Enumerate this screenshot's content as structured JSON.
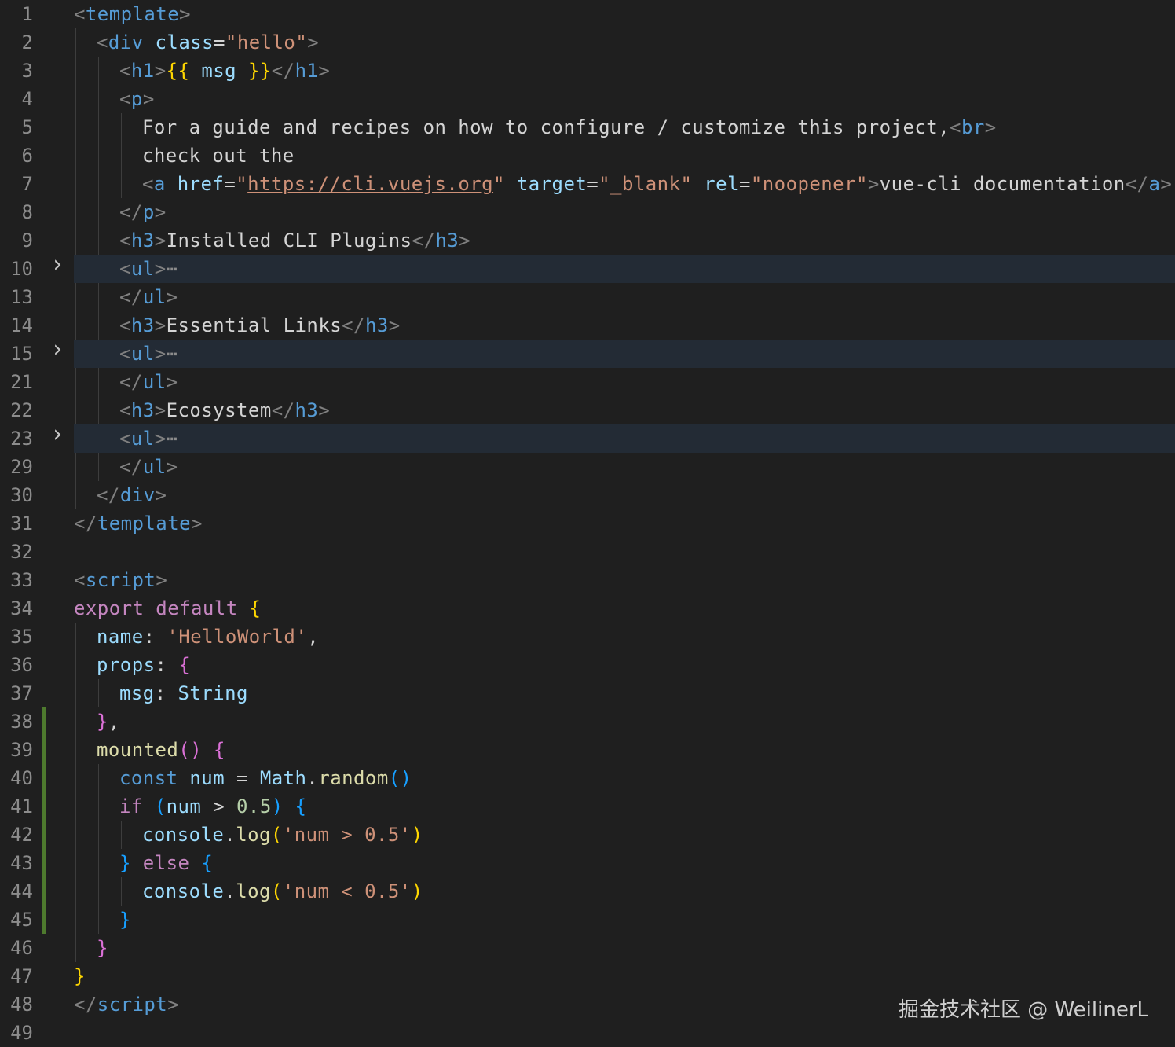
{
  "colors": {
    "background": "#1f1f1f",
    "folded_line_highlight": "#232b35",
    "line_number": "#8c8c8c",
    "git_modified_bar": "#4e7a2e",
    "tag": "#569cd6",
    "string": "#ce9178",
    "attribute": "#9cdcfe",
    "keyword": "#c586c0",
    "function": "#dcdcaa"
  },
  "watermark": "掘金技术社区 @ WeilinerL",
  "lines": [
    {
      "n": "1",
      "indent": 0,
      "tokens": [
        [
          "<",
          "tk-punct"
        ],
        [
          "template",
          "tk-tag"
        ],
        [
          ">",
          "tk-punct"
        ]
      ]
    },
    {
      "n": "2",
      "indent": 1,
      "tokens": [
        [
          "<",
          "tk-punct"
        ],
        [
          "div",
          "tk-tag"
        ],
        [
          " ",
          "tk-text"
        ],
        [
          "class",
          "tk-attr"
        ],
        [
          "=",
          "tk-text"
        ],
        [
          "\"hello\"",
          "tk-str"
        ],
        [
          ">",
          "tk-punct"
        ]
      ]
    },
    {
      "n": "3",
      "indent": 2,
      "tokens": [
        [
          "<",
          "tk-punct"
        ],
        [
          "h1",
          "tk-tag"
        ],
        [
          ">",
          "tk-punct"
        ],
        [
          "{{",
          "tk-brace1"
        ],
        [
          " msg ",
          "tk-var"
        ],
        [
          "}}",
          "tk-brace1"
        ],
        [
          "</",
          "tk-punct"
        ],
        [
          "h1",
          "tk-tag"
        ],
        [
          ">",
          "tk-punct"
        ]
      ]
    },
    {
      "n": "4",
      "indent": 2,
      "tokens": [
        [
          "<",
          "tk-punct"
        ],
        [
          "p",
          "tk-tag"
        ],
        [
          ">",
          "tk-punct"
        ]
      ]
    },
    {
      "n": "5",
      "indent": 3,
      "tokens": [
        [
          "For a guide and recipes on how to configure / customize this project,",
          "tk-text"
        ],
        [
          "<",
          "tk-punct"
        ],
        [
          "br",
          "tk-tag"
        ],
        [
          ">",
          "tk-punct"
        ]
      ]
    },
    {
      "n": "6",
      "indent": 3,
      "tokens": [
        [
          "check out the",
          "tk-text"
        ]
      ]
    },
    {
      "n": "7",
      "indent": 3,
      "tokens": [
        [
          "<",
          "tk-punct"
        ],
        [
          "a",
          "tk-tag"
        ],
        [
          " ",
          "tk-text"
        ],
        [
          "href",
          "tk-attr"
        ],
        [
          "=",
          "tk-text"
        ],
        [
          "\"",
          "tk-str"
        ],
        [
          "https://cli.vuejs.org",
          "tk-link"
        ],
        [
          "\"",
          "tk-str"
        ],
        [
          " ",
          "tk-text"
        ],
        [
          "target",
          "tk-attr"
        ],
        [
          "=",
          "tk-text"
        ],
        [
          "\"_blank\"",
          "tk-str"
        ],
        [
          " ",
          "tk-text"
        ],
        [
          "rel",
          "tk-attr"
        ],
        [
          "=",
          "tk-text"
        ],
        [
          "\"noopener\"",
          "tk-str"
        ],
        [
          ">",
          "tk-punct"
        ],
        [
          "vue-cli documentation",
          "tk-text"
        ],
        [
          "</",
          "tk-punct"
        ],
        [
          "a",
          "tk-tag"
        ],
        [
          ">",
          "tk-punct"
        ],
        [
          ".",
          "tk-text"
        ]
      ]
    },
    {
      "n": "8",
      "indent": 2,
      "tokens": [
        [
          "</",
          "tk-punct"
        ],
        [
          "p",
          "tk-tag"
        ],
        [
          ">",
          "tk-punct"
        ]
      ]
    },
    {
      "n": "9",
      "indent": 2,
      "tokens": [
        [
          "<",
          "tk-punct"
        ],
        [
          "h3",
          "tk-tag"
        ],
        [
          ">",
          "tk-punct"
        ],
        [
          "Installed CLI Plugins",
          "tk-text"
        ],
        [
          "</",
          "tk-punct"
        ],
        [
          "h3",
          "tk-tag"
        ],
        [
          ">",
          "tk-punct"
        ]
      ]
    },
    {
      "n": "10",
      "indent": 2,
      "folded": true,
      "tokens": [
        [
          "<",
          "tk-punct"
        ],
        [
          "ul",
          "tk-tag"
        ],
        [
          ">",
          "tk-punct"
        ],
        [
          "⋯",
          "tk-dots"
        ]
      ]
    },
    {
      "n": "13",
      "indent": 2,
      "tokens": [
        [
          "</",
          "tk-punct"
        ],
        [
          "ul",
          "tk-tag"
        ],
        [
          ">",
          "tk-punct"
        ]
      ]
    },
    {
      "n": "14",
      "indent": 2,
      "tokens": [
        [
          "<",
          "tk-punct"
        ],
        [
          "h3",
          "tk-tag"
        ],
        [
          ">",
          "tk-punct"
        ],
        [
          "Essential Links",
          "tk-text"
        ],
        [
          "</",
          "tk-punct"
        ],
        [
          "h3",
          "tk-tag"
        ],
        [
          ">",
          "tk-punct"
        ]
      ]
    },
    {
      "n": "15",
      "indent": 2,
      "folded": true,
      "tokens": [
        [
          "<",
          "tk-punct"
        ],
        [
          "ul",
          "tk-tag"
        ],
        [
          ">",
          "tk-punct"
        ],
        [
          "⋯",
          "tk-dots"
        ]
      ]
    },
    {
      "n": "21",
      "indent": 2,
      "tokens": [
        [
          "</",
          "tk-punct"
        ],
        [
          "ul",
          "tk-tag"
        ],
        [
          ">",
          "tk-punct"
        ]
      ]
    },
    {
      "n": "22",
      "indent": 2,
      "tokens": [
        [
          "<",
          "tk-punct"
        ],
        [
          "h3",
          "tk-tag"
        ],
        [
          ">",
          "tk-punct"
        ],
        [
          "Ecosystem",
          "tk-text"
        ],
        [
          "</",
          "tk-punct"
        ],
        [
          "h3",
          "tk-tag"
        ],
        [
          ">",
          "tk-punct"
        ]
      ]
    },
    {
      "n": "23",
      "indent": 2,
      "folded": true,
      "tokens": [
        [
          "<",
          "tk-punct"
        ],
        [
          "ul",
          "tk-tag"
        ],
        [
          ">",
          "tk-punct"
        ],
        [
          "⋯",
          "tk-dots"
        ]
      ]
    },
    {
      "n": "29",
      "indent": 2,
      "tokens": [
        [
          "</",
          "tk-punct"
        ],
        [
          "ul",
          "tk-tag"
        ],
        [
          ">",
          "tk-punct"
        ]
      ]
    },
    {
      "n": "30",
      "indent": 1,
      "tokens": [
        [
          "</",
          "tk-punct"
        ],
        [
          "div",
          "tk-tag"
        ],
        [
          ">",
          "tk-punct"
        ]
      ]
    },
    {
      "n": "31",
      "indent": 0,
      "tokens": [
        [
          "</",
          "tk-punct"
        ],
        [
          "template",
          "tk-tag"
        ],
        [
          ">",
          "tk-punct"
        ]
      ]
    },
    {
      "n": "32",
      "indent": 0,
      "tokens": []
    },
    {
      "n": "33",
      "indent": 0,
      "tokens": [
        [
          "<",
          "tk-punct"
        ],
        [
          "script",
          "tk-tag"
        ],
        [
          ">",
          "tk-punct"
        ]
      ]
    },
    {
      "n": "34",
      "indent": 0,
      "tokens": [
        [
          "export default ",
          "tk-kw"
        ],
        [
          "{",
          "tk-brace1"
        ]
      ]
    },
    {
      "n": "35",
      "indent": 1,
      "tokens": [
        [
          "name",
          "tk-var"
        ],
        [
          ": ",
          "tk-text"
        ],
        [
          "'HelloWorld'",
          "tk-str"
        ],
        [
          ",",
          "tk-text"
        ]
      ]
    },
    {
      "n": "36",
      "indent": 1,
      "tokens": [
        [
          "props",
          "tk-var"
        ],
        [
          ": ",
          "tk-text"
        ],
        [
          "{",
          "tk-brace2"
        ]
      ]
    },
    {
      "n": "37",
      "indent": 2,
      "tokens": [
        [
          "msg",
          "tk-var"
        ],
        [
          ": ",
          "tk-text"
        ],
        [
          "String",
          "tk-var"
        ]
      ]
    },
    {
      "n": "38",
      "indent": 1,
      "tokens": [
        [
          "}",
          "tk-brace2"
        ],
        [
          ",",
          "tk-text"
        ]
      ]
    },
    {
      "n": "39",
      "indent": 1,
      "tokens": [
        [
          "mounted",
          "tk-fn"
        ],
        [
          "()",
          "tk-brace2"
        ],
        [
          " ",
          "tk-text"
        ],
        [
          "{",
          "tk-brace2"
        ]
      ]
    },
    {
      "n": "40",
      "indent": 2,
      "tokens": [
        [
          "const ",
          "tk-kw2"
        ],
        [
          "num",
          "tk-var"
        ],
        [
          " = ",
          "tk-text"
        ],
        [
          "Math",
          "tk-var"
        ],
        [
          ".",
          "tk-text"
        ],
        [
          "random",
          "tk-fn"
        ],
        [
          "()",
          "tk-brace3"
        ]
      ]
    },
    {
      "n": "41",
      "indent": 2,
      "tokens": [
        [
          "if ",
          "tk-kw"
        ],
        [
          "(",
          "tk-brace3"
        ],
        [
          "num",
          "tk-var"
        ],
        [
          " > ",
          "tk-text"
        ],
        [
          "0.5",
          "tk-num"
        ],
        [
          ")",
          "tk-brace3"
        ],
        [
          " ",
          "tk-text"
        ],
        [
          "{",
          "tk-brace3"
        ]
      ]
    },
    {
      "n": "42",
      "indent": 3,
      "tokens": [
        [
          "console",
          "tk-var"
        ],
        [
          ".",
          "tk-text"
        ],
        [
          "log",
          "tk-fn"
        ],
        [
          "(",
          "tk-brace1"
        ],
        [
          "'num > 0.5'",
          "tk-str"
        ],
        [
          ")",
          "tk-brace1"
        ]
      ]
    },
    {
      "n": "43",
      "indent": 2,
      "tokens": [
        [
          "}",
          "tk-brace3"
        ],
        [
          " else ",
          "tk-kw"
        ],
        [
          "{",
          "tk-brace3"
        ]
      ]
    },
    {
      "n": "44",
      "indent": 3,
      "tokens": [
        [
          "console",
          "tk-var"
        ],
        [
          ".",
          "tk-text"
        ],
        [
          "log",
          "tk-fn"
        ],
        [
          "(",
          "tk-brace1"
        ],
        [
          "'num < 0.5'",
          "tk-str"
        ],
        [
          ")",
          "tk-brace1"
        ]
      ]
    },
    {
      "n": "45",
      "indent": 2,
      "tokens": [
        [
          "}",
          "tk-brace3"
        ]
      ]
    },
    {
      "n": "46",
      "indent": 1,
      "tokens": [
        [
          "}",
          "tk-brace2"
        ]
      ]
    },
    {
      "n": "47",
      "indent": 0,
      "tokens": [
        [
          "}",
          "tk-brace1"
        ]
      ]
    },
    {
      "n": "48",
      "indent": 0,
      "tokens": [
        [
          "</",
          "tk-punct"
        ],
        [
          "script",
          "tk-tag"
        ],
        [
          ">",
          "tk-punct"
        ]
      ]
    },
    {
      "n": "49",
      "indent": 0,
      "tokens": []
    }
  ]
}
